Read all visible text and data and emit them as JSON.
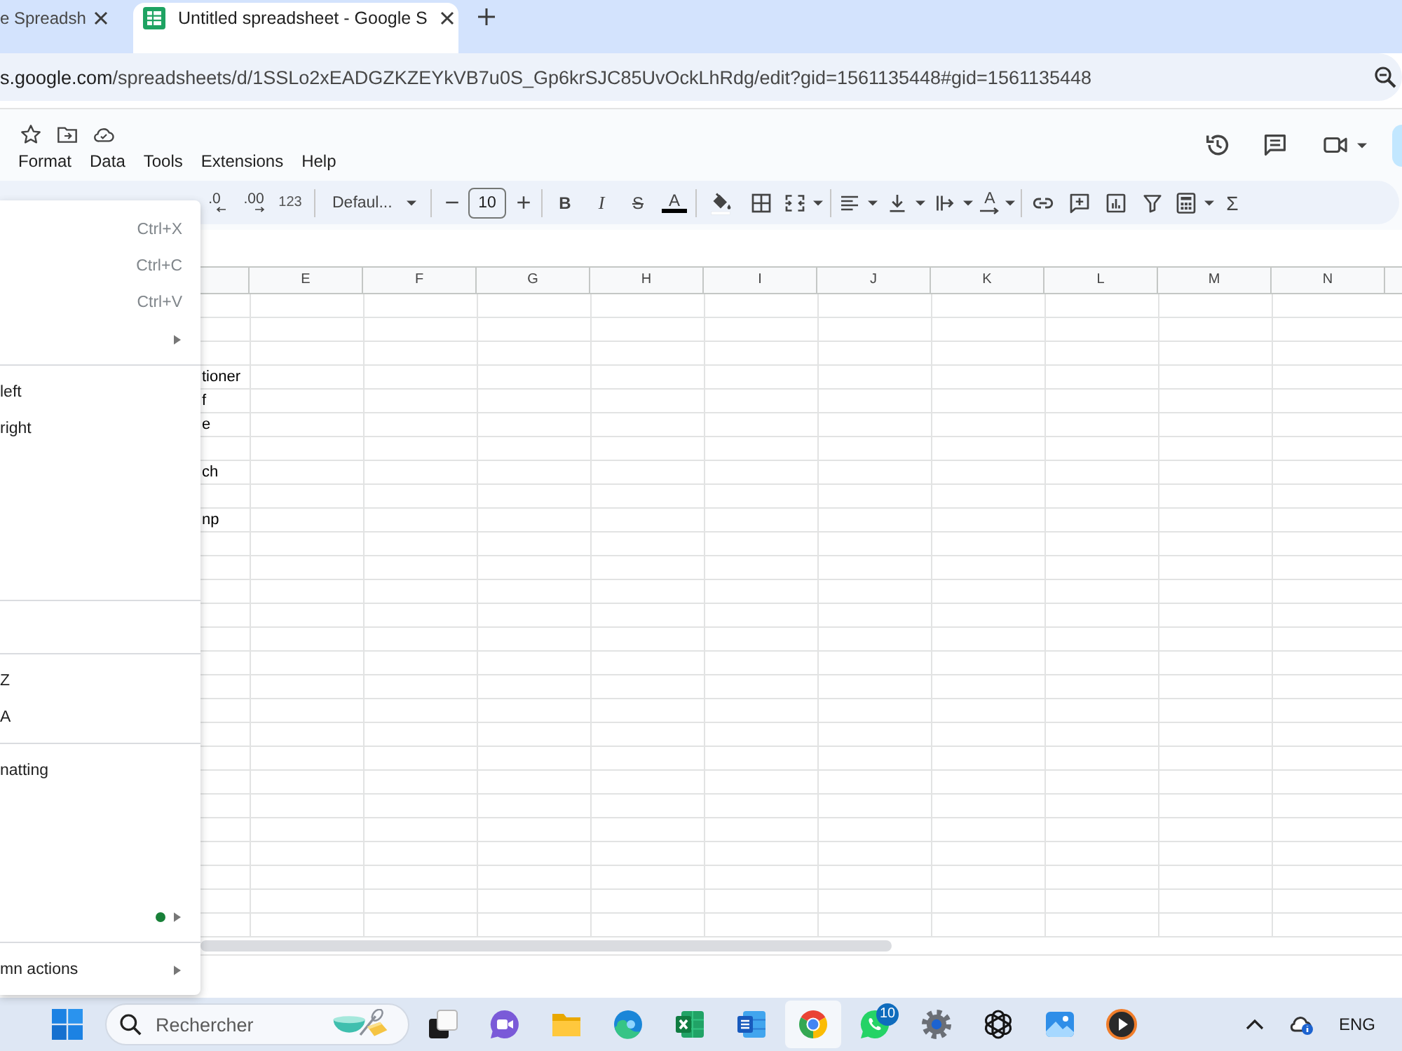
{
  "browser": {
    "tabs": [
      {
        "title": "e Spreadsh",
        "selected": false
      },
      {
        "title": "Untitled spreadsheet - Google S",
        "selected": true
      }
    ],
    "address": {
      "host": "s.google.com",
      "path": "/spreadsheets/d/1SSLo2xEADGZKZEYkVB7u0S_Gp6krSJC85UvOckLhRdg/edit?gid=1561135448#gid=1561135448"
    }
  },
  "sheets_header": {
    "menu": [
      "Format",
      "Data",
      "Tools",
      "Extensions",
      "Help"
    ]
  },
  "toolbar": {
    "decrease_decimal": ".0",
    "increase_decimal": ".00",
    "number_format": "123",
    "font": "Defaul...",
    "font_size": "10",
    "bold": "B",
    "italic": "I",
    "strikethrough": "S",
    "text_color": "A",
    "text_rotation": "A",
    "sum": "Σ"
  },
  "sheet": {
    "columns": [
      "E",
      "F",
      "G",
      "H",
      "I",
      "J",
      "K",
      "L",
      "M",
      "N"
    ],
    "rows": [
      {
        "kind": "blank"
      },
      {
        "kind": "blank"
      },
      {
        "kind": "blank"
      },
      {
        "kind": "text",
        "cell": "tioner"
      },
      {
        "kind": "text",
        "cell": "f"
      },
      {
        "kind": "text",
        "cell": "e"
      },
      {
        "kind": "blank"
      },
      {
        "kind": "text",
        "cell": "ch"
      },
      {
        "kind": "blank"
      },
      {
        "kind": "text",
        "cell": "np"
      },
      {
        "kind": "blank"
      },
      {
        "kind": "blank"
      },
      {
        "kind": "blank"
      },
      {
        "kind": "blank"
      },
      {
        "kind": "blank"
      },
      {
        "kind": "blank"
      },
      {
        "kind": "blank"
      },
      {
        "kind": "blank"
      },
      {
        "kind": "blank"
      },
      {
        "kind": "blank"
      },
      {
        "kind": "blank"
      },
      {
        "kind": "blank"
      },
      {
        "kind": "blank"
      },
      {
        "kind": "blank"
      },
      {
        "kind": "blank"
      },
      {
        "kind": "blank"
      },
      {
        "kind": "blank"
      }
    ]
  },
  "context_menu": {
    "items": [
      {
        "kind": "item",
        "shortcut": "Ctrl+X",
        "submenu": false
      },
      {
        "kind": "item",
        "shortcut": "Ctrl+C",
        "submenu": false
      },
      {
        "kind": "item",
        "shortcut": "Ctrl+V",
        "submenu": false
      },
      {
        "kind": "item",
        "submenu": true
      },
      {
        "kind": "divider"
      },
      {
        "kind": "item",
        "label": "left",
        "submenu": false
      },
      {
        "kind": "item",
        "label": "right",
        "submenu": false
      },
      {
        "kind": "blank"
      },
      {
        "kind": "blank"
      },
      {
        "kind": "blank"
      },
      {
        "kind": "blank"
      },
      {
        "kind": "divider"
      },
      {
        "kind": "blank"
      },
      {
        "kind": "divider"
      },
      {
        "kind": "item",
        "label": "Z",
        "submenu": false
      },
      {
        "kind": "item",
        "label": "A",
        "submenu": false
      },
      {
        "kind": "divider"
      },
      {
        "kind": "item",
        "label": "natting",
        "submenu": false
      },
      {
        "kind": "blank"
      },
      {
        "kind": "blank"
      },
      {
        "kind": "blank"
      },
      {
        "kind": "item",
        "submenu": true,
        "dot": true
      },
      {
        "kind": "divider"
      },
      {
        "kind": "item",
        "label": "mn actions",
        "submenu": true
      }
    ]
  },
  "taskbar": {
    "search_placeholder": "Rechercher",
    "apps": [
      {
        "selected": false
      },
      {
        "selected": false
      },
      {
        "selected": false
      },
      {
        "selected": false
      },
      {
        "selected": false
      },
      {
        "selected": false
      },
      {
        "selected": true
      },
      {
        "selected": false,
        "badge": "10"
      },
      {
        "selected": false
      },
      {
        "selected": false
      },
      {
        "selected": false
      },
      {
        "selected": false
      }
    ],
    "language": "ENG"
  }
}
